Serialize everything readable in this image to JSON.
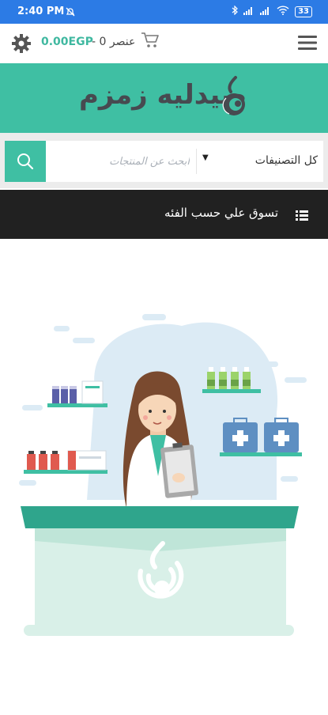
{
  "status_bar": {
    "time": "2:40 PM",
    "battery": "33"
  },
  "header": {
    "price": "0.00EGP",
    "separator": " - ",
    "items": "0 عنصر",
    "icons": {
      "settings": "gear-icon",
      "cart": "cart-icon",
      "menu": "hamburger-menu-icon"
    }
  },
  "brand": {
    "name": "صيدليه زمزم",
    "color": "#3fbfa3"
  },
  "search": {
    "placeholder": "ابحث عن المنتجات",
    "category": "كل التصنيفات"
  },
  "category_bar": {
    "label": "تسوق علي حسب الفئه"
  }
}
